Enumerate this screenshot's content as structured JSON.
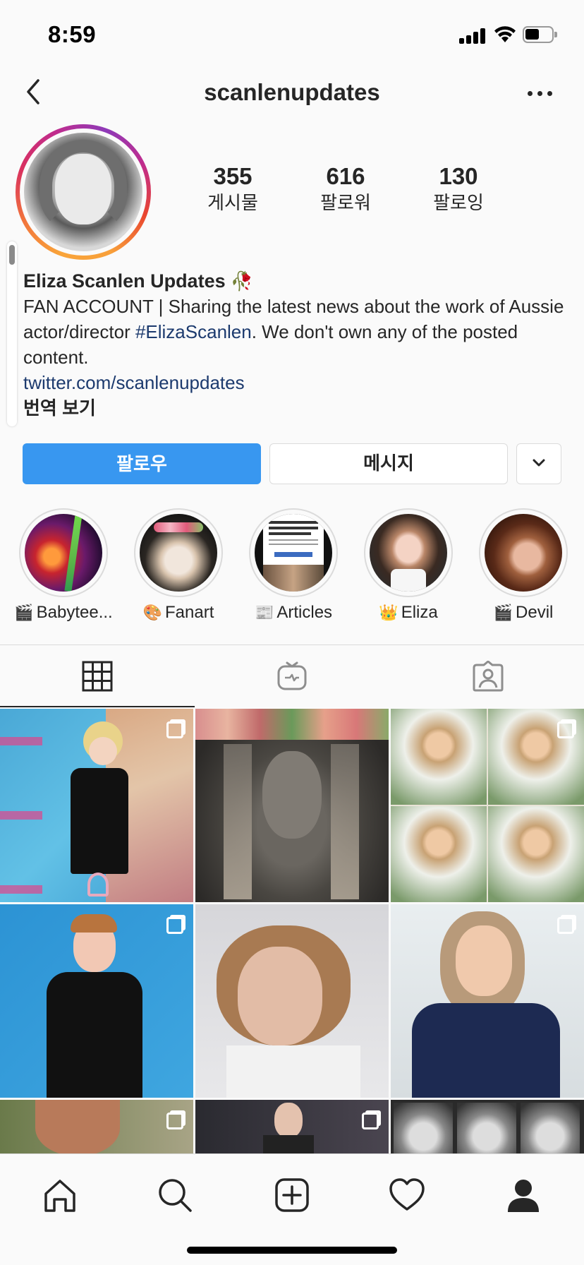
{
  "status_bar": {
    "time": "8:59"
  },
  "header": {
    "title": "scanlenupdates"
  },
  "stats": [
    {
      "count": "355",
      "label": "게시물"
    },
    {
      "count": "616",
      "label": "팔로워"
    },
    {
      "count": "130",
      "label": "팔로잉"
    }
  ],
  "bio": {
    "name": "Eliza Scanlen Updates",
    "name_emoji": "🥀",
    "text_before": "FAN ACCOUNT | Sharing the latest news about the work of Aussie actor/director ",
    "hashtag": "#ElizaScanlen",
    "text_after": ". We don't own any of the posted content.",
    "link": "twitter.com/scanlenupdates",
    "translate": "번역 보기"
  },
  "buttons": {
    "follow": "팔로우",
    "message": "메시지"
  },
  "highlights": [
    {
      "emoji": "🎬",
      "label": "Babytee..."
    },
    {
      "emoji": "🎨",
      "label": "Fanart"
    },
    {
      "emoji": "📰",
      "label": "Articles"
    },
    {
      "emoji": "👑",
      "label": "Eliza"
    },
    {
      "emoji": "🎬",
      "label": "Devil"
    }
  ],
  "tabs": [
    "grid-icon",
    "igtv-icon",
    "tagged-icon"
  ],
  "bottom_nav": [
    "home-icon",
    "search-icon",
    "new-post-icon",
    "activity-icon",
    "profile-icon"
  ]
}
